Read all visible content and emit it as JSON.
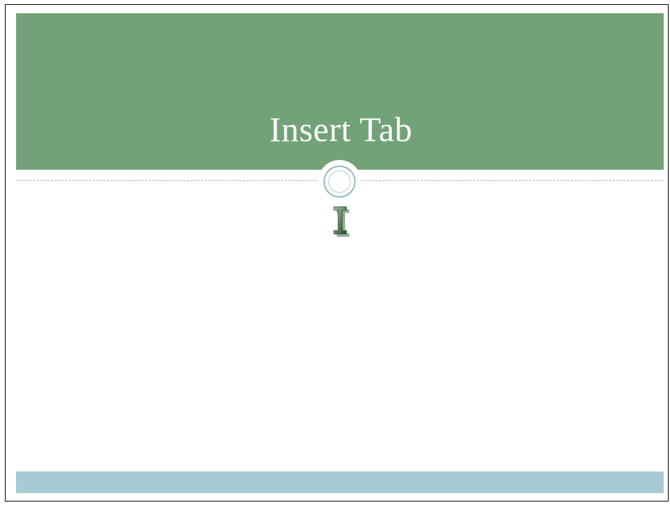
{
  "slide": {
    "title": "Insert Tab"
  },
  "icons": {
    "cursor": "text-cursor-ibeam-icon",
    "ornament": "circle-ornament-icon"
  },
  "colors": {
    "header": "#72a278",
    "footer": "#a7cbd4",
    "accent_line": "#9ab6bf",
    "title_text": "#ffffff",
    "cursor": "#5f8a63"
  }
}
